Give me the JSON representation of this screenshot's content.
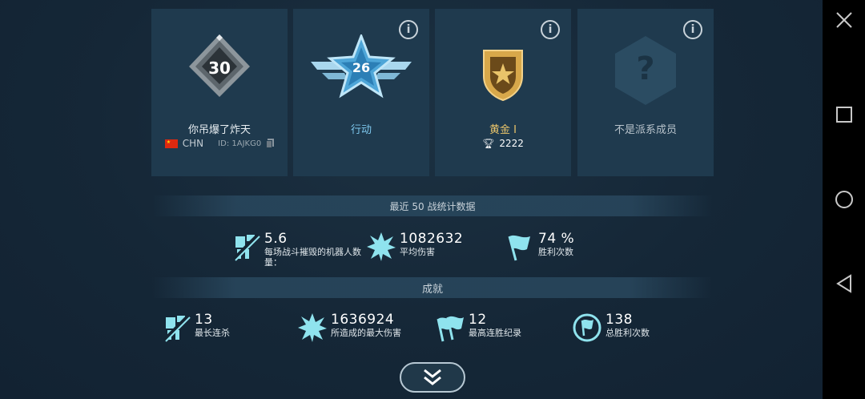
{
  "colors": {
    "accent": "#8fe3ee",
    "gold": "#d8a84a",
    "card": "#1f3a4e"
  },
  "cards": {
    "player": {
      "level": "30",
      "name": "你吊爆了炸天",
      "country": "CHN",
      "id": "ID: 1AJKG0"
    },
    "rank": {
      "number": "26",
      "label": "行动",
      "info": "i"
    },
    "league": {
      "label": "黄金 I",
      "trophies": "2222",
      "info": "i"
    },
    "squad": {
      "label": "不是派系成员",
      "info": "i",
      "mark": "?"
    }
  },
  "recent": {
    "header": "最近 50 战统计数据",
    "stats": [
      {
        "value": "5.6",
        "label": "每场战斗摧毁的机器人数量：",
        "icon": "robot-kill-icon"
      },
      {
        "value": "1082632",
        "label": "平均伤害",
        "icon": "explosion-icon"
      },
      {
        "value": "74 %",
        "label": "胜利次数",
        "icon": "flag-icon"
      }
    ]
  },
  "achievements": {
    "header": "成就",
    "stats": [
      {
        "value": "13",
        "label": "最长连杀",
        "icon": "robot-kill-icon"
      },
      {
        "value": "1636924",
        "label": "所造成的最大伤害",
        "icon": "explosion-icon"
      },
      {
        "value": "12",
        "label": "最高连胜纪录",
        "icon": "double-flag-icon"
      },
      {
        "value": "138",
        "label": "总胜利次数",
        "icon": "circle-flag-icon"
      }
    ]
  }
}
